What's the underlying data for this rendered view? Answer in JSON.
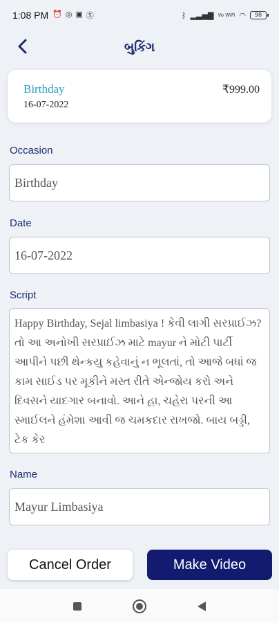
{
  "status_bar": {
    "time": "1:08 PM",
    "left_icons": [
      "alarm-icon",
      "whatsapp-icon",
      "message-icon",
      "sim-icon"
    ],
    "battery": "98",
    "network": "Vo WiFi"
  },
  "header": {
    "title": "બુકિંગ",
    "back_icon": "chevron-left-icon"
  },
  "summary": {
    "occasion": "Birthday",
    "date": "16-07-2022",
    "price": "₹999.00"
  },
  "form": {
    "occasion": {
      "label": "Occasion",
      "value": "Birthday"
    },
    "date": {
      "label": "Date",
      "value": "16-07-2022"
    },
    "script": {
      "label": "Script",
      "value": "Happy Birthday,  Sejal limbasiya ! કેવી લાગી સરપ્રાઈઝ? તો આ અનોખી સરપ્રાઈઝ માટે  mayur  ને મોટી પાર્ટી આપીને પછી થેન્કયુ કહેવાનું ન ભૂલતાં, તો આજે બધાં જ કામ સાઈડ પર મૂકીને મસ્ત રીતે એન્જોય કરો અને દિવસને યાદગાર બનાવો. આને હા, ચહેરા પરની આ સ્માઈલને હંમેશા આવી જ ચમકદાર રાખજો. બાય બડ્ડી, ટેક કેર"
    },
    "name": {
      "label": "Name",
      "value": "Mayur Limbasiya"
    }
  },
  "buttons": {
    "cancel": "Cancel Order",
    "make_video": "Make Video"
  },
  "nav": [
    "recents-square-icon",
    "home-circle-icon",
    "back-triangle-icon"
  ],
  "colors": {
    "primary": "#121b6f",
    "title": "#1c2a6b",
    "accent": "#2a9bc0",
    "background": "#eef2f6"
  }
}
